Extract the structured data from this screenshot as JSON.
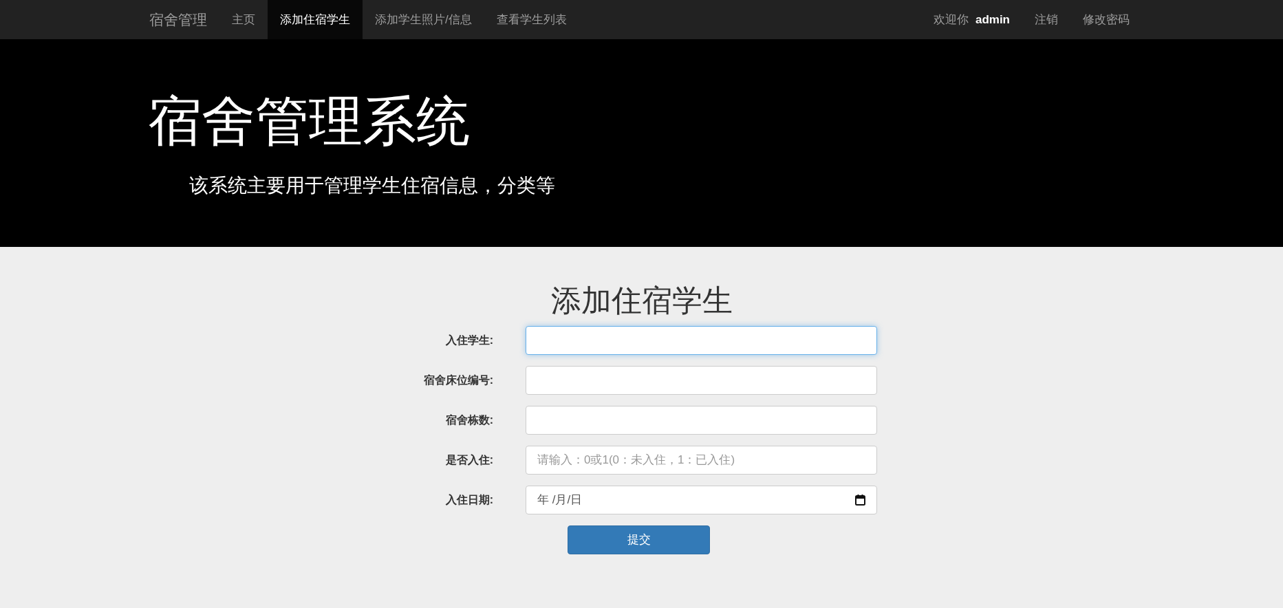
{
  "navbar": {
    "brand": "宿舍管理",
    "items": [
      {
        "label": "主页",
        "selected": false
      },
      {
        "label": "添加住宿学生",
        "selected": true
      },
      {
        "label": "添加学生照片/信息",
        "selected": false
      },
      {
        "label": "查看学生列表",
        "selected": false
      }
    ],
    "welcome": "欢迎你",
    "user": "admin",
    "links": [
      "注销",
      "修改密码"
    ]
  },
  "hero": {
    "title": "宿舍管理系统",
    "subtitle": "该系统主要用于管理学生住宿信息，分类等"
  },
  "form": {
    "title": "添加住宿学生",
    "fields": [
      {
        "label": "入住学生:",
        "kind": "text",
        "focused": true
      },
      {
        "label": "宿舍床位编号:",
        "kind": "text",
        "focused": false
      },
      {
        "label": "宿舍栋数:",
        "kind": "text",
        "focused": false
      },
      {
        "label": "是否入住:",
        "kind": "text",
        "focused": false,
        "placeholder": "请输入：0或1(0：未入住，1：已入住)"
      },
      {
        "label": "入住日期:",
        "kind": "date",
        "focused": false,
        "value": "年 /月/日"
      }
    ],
    "submit": "提交"
  }
}
